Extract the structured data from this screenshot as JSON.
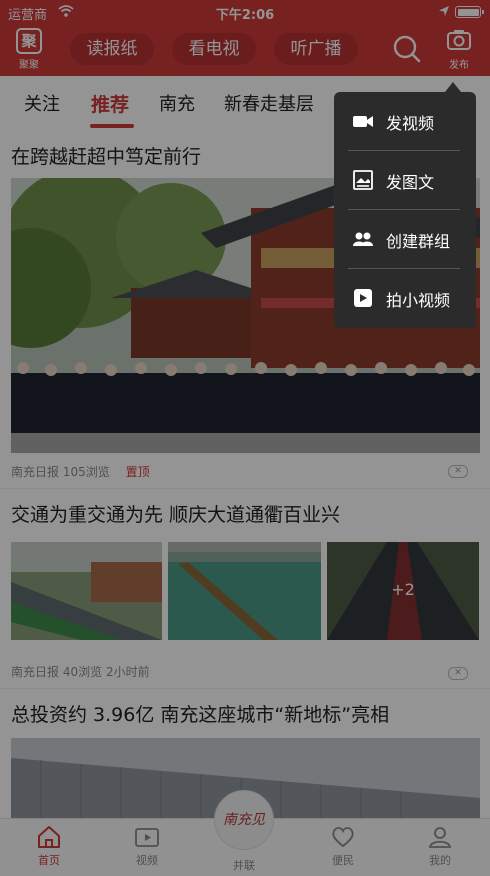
{
  "status_bar": {
    "carrier": "运营商",
    "time": "下午2:06"
  },
  "header": {
    "logo_label": "聚聚",
    "pills": [
      "读报纸",
      "看电视",
      "听广播"
    ],
    "publish_label": "发布"
  },
  "tabs": [
    {
      "label": "关注",
      "active": false
    },
    {
      "label": "推荐",
      "active": true
    },
    {
      "label": "南充",
      "active": false
    },
    {
      "label": "新春走基层",
      "active": false
    }
  ],
  "articles": [
    {
      "title": "在跨越赶超中笃定前行",
      "source": "南充日报",
      "views": "105浏览",
      "pinned": "置顶",
      "time": ""
    },
    {
      "title": "交通为重交通为先 顺庆大道通衢百业兴",
      "source": "南充日报",
      "views": "40浏览",
      "pinned": "",
      "time": "2小时前",
      "extra_images": "+2"
    },
    {
      "title": "总投资约 3.96亿 南充这座城市“新地标”亮相"
    }
  ],
  "publish_menu": {
    "items": [
      {
        "label": "发视频",
        "icon": "video-camera-icon"
      },
      {
        "label": "发图文",
        "icon": "image-text-icon"
      },
      {
        "label": "创建群组",
        "icon": "group-icon"
      },
      {
        "label": "拍小视频",
        "icon": "play-icon"
      }
    ]
  },
  "bottom_nav": {
    "items": [
      {
        "label": "首页",
        "icon": "home-icon",
        "active": true
      },
      {
        "label": "视频",
        "icon": "video-icon",
        "active": false
      },
      {
        "label": "并联",
        "icon": "center-logo",
        "active": false
      },
      {
        "label": "便民",
        "icon": "heart-icon",
        "active": false
      },
      {
        "label": "我的",
        "icon": "user-icon",
        "active": false
      }
    ],
    "center_logo_text": "南充见"
  },
  "colors": {
    "brand": "#cf3a3a",
    "menu_bg": "#2b2b2b"
  }
}
